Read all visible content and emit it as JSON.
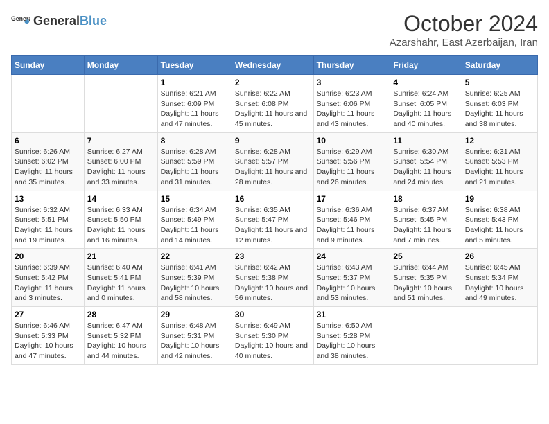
{
  "header": {
    "logo_general": "General",
    "logo_blue": "Blue",
    "title": "October 2024",
    "subtitle": "Azarshahr, East Azerbaijan, Iran"
  },
  "days_of_week": [
    "Sunday",
    "Monday",
    "Tuesday",
    "Wednesday",
    "Thursday",
    "Friday",
    "Saturday"
  ],
  "weeks": [
    [
      {
        "day": "",
        "sunrise": "",
        "sunset": "",
        "daylight": ""
      },
      {
        "day": "",
        "sunrise": "",
        "sunset": "",
        "daylight": ""
      },
      {
        "day": "1",
        "sunrise": "Sunrise: 6:21 AM",
        "sunset": "Sunset: 6:09 PM",
        "daylight": "Daylight: 11 hours and 47 minutes."
      },
      {
        "day": "2",
        "sunrise": "Sunrise: 6:22 AM",
        "sunset": "Sunset: 6:08 PM",
        "daylight": "Daylight: 11 hours and 45 minutes."
      },
      {
        "day": "3",
        "sunrise": "Sunrise: 6:23 AM",
        "sunset": "Sunset: 6:06 PM",
        "daylight": "Daylight: 11 hours and 43 minutes."
      },
      {
        "day": "4",
        "sunrise": "Sunrise: 6:24 AM",
        "sunset": "Sunset: 6:05 PM",
        "daylight": "Daylight: 11 hours and 40 minutes."
      },
      {
        "day": "5",
        "sunrise": "Sunrise: 6:25 AM",
        "sunset": "Sunset: 6:03 PM",
        "daylight": "Daylight: 11 hours and 38 minutes."
      }
    ],
    [
      {
        "day": "6",
        "sunrise": "Sunrise: 6:26 AM",
        "sunset": "Sunset: 6:02 PM",
        "daylight": "Daylight: 11 hours and 35 minutes."
      },
      {
        "day": "7",
        "sunrise": "Sunrise: 6:27 AM",
        "sunset": "Sunset: 6:00 PM",
        "daylight": "Daylight: 11 hours and 33 minutes."
      },
      {
        "day": "8",
        "sunrise": "Sunrise: 6:28 AM",
        "sunset": "Sunset: 5:59 PM",
        "daylight": "Daylight: 11 hours and 31 minutes."
      },
      {
        "day": "9",
        "sunrise": "Sunrise: 6:28 AM",
        "sunset": "Sunset: 5:57 PM",
        "daylight": "Daylight: 11 hours and 28 minutes."
      },
      {
        "day": "10",
        "sunrise": "Sunrise: 6:29 AM",
        "sunset": "Sunset: 5:56 PM",
        "daylight": "Daylight: 11 hours and 26 minutes."
      },
      {
        "day": "11",
        "sunrise": "Sunrise: 6:30 AM",
        "sunset": "Sunset: 5:54 PM",
        "daylight": "Daylight: 11 hours and 24 minutes."
      },
      {
        "day": "12",
        "sunrise": "Sunrise: 6:31 AM",
        "sunset": "Sunset: 5:53 PM",
        "daylight": "Daylight: 11 hours and 21 minutes."
      }
    ],
    [
      {
        "day": "13",
        "sunrise": "Sunrise: 6:32 AM",
        "sunset": "Sunset: 5:51 PM",
        "daylight": "Daylight: 11 hours and 19 minutes."
      },
      {
        "day": "14",
        "sunrise": "Sunrise: 6:33 AM",
        "sunset": "Sunset: 5:50 PM",
        "daylight": "Daylight: 11 hours and 16 minutes."
      },
      {
        "day": "15",
        "sunrise": "Sunrise: 6:34 AM",
        "sunset": "Sunset: 5:49 PM",
        "daylight": "Daylight: 11 hours and 14 minutes."
      },
      {
        "day": "16",
        "sunrise": "Sunrise: 6:35 AM",
        "sunset": "Sunset: 5:47 PM",
        "daylight": "Daylight: 11 hours and 12 minutes."
      },
      {
        "day": "17",
        "sunrise": "Sunrise: 6:36 AM",
        "sunset": "Sunset: 5:46 PM",
        "daylight": "Daylight: 11 hours and 9 minutes."
      },
      {
        "day": "18",
        "sunrise": "Sunrise: 6:37 AM",
        "sunset": "Sunset: 5:45 PM",
        "daylight": "Daylight: 11 hours and 7 minutes."
      },
      {
        "day": "19",
        "sunrise": "Sunrise: 6:38 AM",
        "sunset": "Sunset: 5:43 PM",
        "daylight": "Daylight: 11 hours and 5 minutes."
      }
    ],
    [
      {
        "day": "20",
        "sunrise": "Sunrise: 6:39 AM",
        "sunset": "Sunset: 5:42 PM",
        "daylight": "Daylight: 11 hours and 3 minutes."
      },
      {
        "day": "21",
        "sunrise": "Sunrise: 6:40 AM",
        "sunset": "Sunset: 5:41 PM",
        "daylight": "Daylight: 11 hours and 0 minutes."
      },
      {
        "day": "22",
        "sunrise": "Sunrise: 6:41 AM",
        "sunset": "Sunset: 5:39 PM",
        "daylight": "Daylight: 10 hours and 58 minutes."
      },
      {
        "day": "23",
        "sunrise": "Sunrise: 6:42 AM",
        "sunset": "Sunset: 5:38 PM",
        "daylight": "Daylight: 10 hours and 56 minutes."
      },
      {
        "day": "24",
        "sunrise": "Sunrise: 6:43 AM",
        "sunset": "Sunset: 5:37 PM",
        "daylight": "Daylight: 10 hours and 53 minutes."
      },
      {
        "day": "25",
        "sunrise": "Sunrise: 6:44 AM",
        "sunset": "Sunset: 5:35 PM",
        "daylight": "Daylight: 10 hours and 51 minutes."
      },
      {
        "day": "26",
        "sunrise": "Sunrise: 6:45 AM",
        "sunset": "Sunset: 5:34 PM",
        "daylight": "Daylight: 10 hours and 49 minutes."
      }
    ],
    [
      {
        "day": "27",
        "sunrise": "Sunrise: 6:46 AM",
        "sunset": "Sunset: 5:33 PM",
        "daylight": "Daylight: 10 hours and 47 minutes."
      },
      {
        "day": "28",
        "sunrise": "Sunrise: 6:47 AM",
        "sunset": "Sunset: 5:32 PM",
        "daylight": "Daylight: 10 hours and 44 minutes."
      },
      {
        "day": "29",
        "sunrise": "Sunrise: 6:48 AM",
        "sunset": "Sunset: 5:31 PM",
        "daylight": "Daylight: 10 hours and 42 minutes."
      },
      {
        "day": "30",
        "sunrise": "Sunrise: 6:49 AM",
        "sunset": "Sunset: 5:30 PM",
        "daylight": "Daylight: 10 hours and 40 minutes."
      },
      {
        "day": "31",
        "sunrise": "Sunrise: 6:50 AM",
        "sunset": "Sunset: 5:28 PM",
        "daylight": "Daylight: 10 hours and 38 minutes."
      },
      {
        "day": "",
        "sunrise": "",
        "sunset": "",
        "daylight": ""
      },
      {
        "day": "",
        "sunrise": "",
        "sunset": "",
        "daylight": ""
      }
    ]
  ]
}
